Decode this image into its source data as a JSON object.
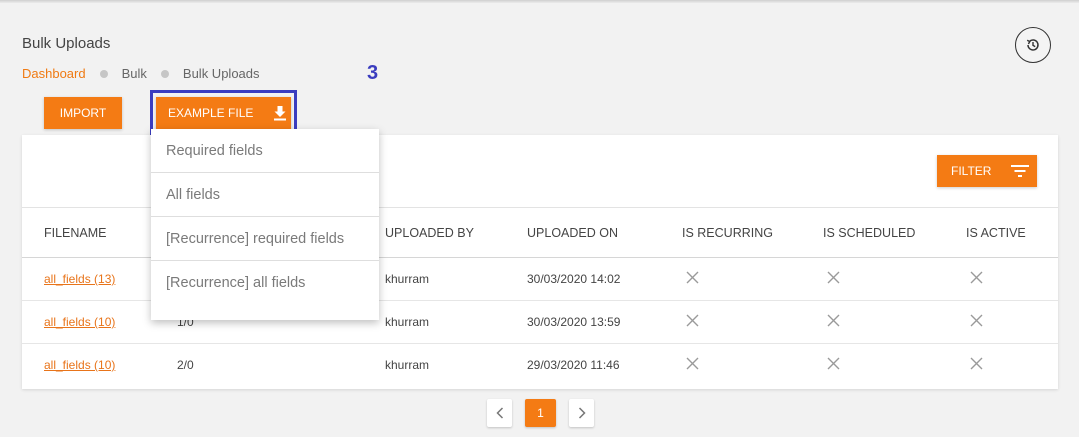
{
  "page": {
    "title": "Bulk Uploads"
  },
  "breadcrumb": [
    "Dashboard",
    "Bulk",
    "Bulk Uploads"
  ],
  "annotation": {
    "step": "3"
  },
  "toolbar": {
    "import_label": "IMPORT",
    "example_label": "EXAMPLE FILE"
  },
  "dropdown": {
    "items": [
      "Required fields",
      "All fields",
      "[Recurrence] required fields",
      "[Recurrence] all fields"
    ]
  },
  "filter": {
    "label": "FILTER"
  },
  "table": {
    "columns": [
      "FILENAME",
      "",
      "UPLOADED BY",
      "UPLOADED ON",
      "IS RECURRING",
      "IS SCHEDULED",
      "IS ACTIVE"
    ],
    "rows": [
      {
        "filename": "all_fields (13)",
        "status": "",
        "uploaded_by": "khurram",
        "uploaded_on": "30/03/2020 14:02",
        "is_recurring": "false",
        "is_scheduled": "false",
        "is_active": "false"
      },
      {
        "filename": "all_fields (10)",
        "status": "1/0",
        "uploaded_by": "khurram",
        "uploaded_on": "30/03/2020 13:59",
        "is_recurring": "false",
        "is_scheduled": "false",
        "is_active": "false"
      },
      {
        "filename": "all_fields (10)",
        "status": "2/0",
        "uploaded_by": "khurram",
        "uploaded_on": "29/03/2020 11:46",
        "is_recurring": "false",
        "is_scheduled": "false",
        "is_active": "false"
      }
    ]
  },
  "pagination": {
    "current": "1"
  },
  "icons": {
    "history": "history-icon",
    "download": "download-icon",
    "filter": "filter-icon",
    "cross": "x-icon",
    "prev": "chevron-left-icon",
    "next": "chevron-right-icon"
  },
  "colors": {
    "accent": "#f47b14",
    "highlight": "#3b3dbf",
    "link": "#e8741a"
  }
}
